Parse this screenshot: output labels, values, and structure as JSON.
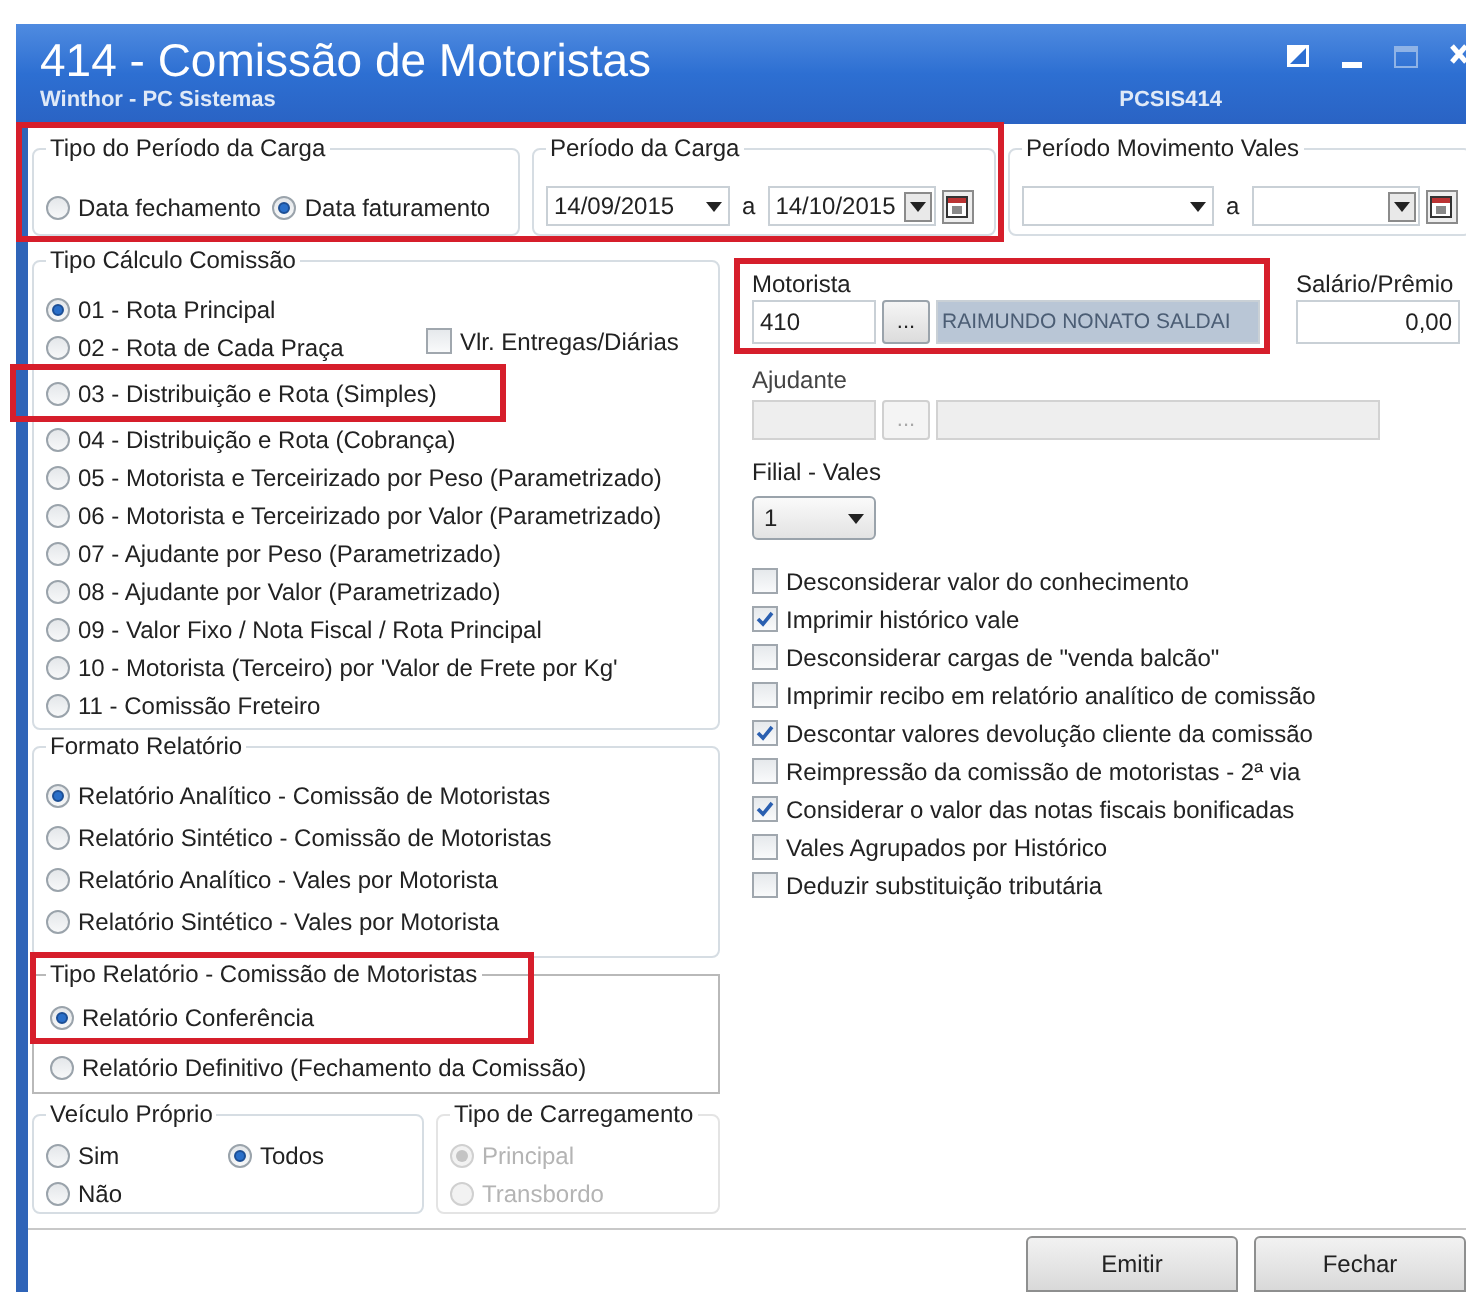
{
  "window": {
    "title": "414 - Comissão de Motoristas",
    "subtitle": "Winthor - PC Sistemas",
    "code": "PCSIS414"
  },
  "tipo_periodo_carga": {
    "title": "Tipo do Período da Carga",
    "options": [
      {
        "label": "Data fechamento",
        "selected": false
      },
      {
        "label": "Data faturamento",
        "selected": true
      }
    ]
  },
  "periodo_carga": {
    "title": "Período da Carga",
    "from": "14/09/2015",
    "separator": "a",
    "to": "14/10/2015"
  },
  "periodo_movimento_vales": {
    "title": "Período Movimento Vales",
    "separator": "a"
  },
  "tipo_calculo_comissao": {
    "title": "Tipo Cálculo Comissão",
    "options": [
      {
        "label": "01 - Rota Principal",
        "selected": true
      },
      {
        "label": "02 - Rota de Cada Praça",
        "selected": false
      },
      {
        "label": "03 - Distribuição e Rota (Simples)",
        "selected": false
      },
      {
        "label": "04 - Distribuição e Rota (Cobrança)",
        "selected": false
      },
      {
        "label": "05 - Motorista e Terceirizado por Peso (Parametrizado)",
        "selected": false
      },
      {
        "label": "06 - Motorista e Terceirizado por Valor (Parametrizado)",
        "selected": false
      },
      {
        "label": "07 - Ajudante por Peso (Parametrizado)",
        "selected": false
      },
      {
        "label": "08 - Ajudante por Valor (Parametrizado)",
        "selected": false
      },
      {
        "label": "09 - Valor Fixo / Nota Fiscal / Rota Principal",
        "selected": false
      },
      {
        "label": "10 - Motorista (Terceiro) por 'Valor de Frete por Kg'",
        "selected": false
      },
      {
        "label": "11 - Comissão Freteiro",
        "selected": false
      }
    ],
    "checkbox": {
      "label": "Vlr. Entregas/Diárias",
      "checked": false
    }
  },
  "formato_relatorio": {
    "title": "Formato Relatório",
    "options": [
      {
        "label": "Relatório Analítico - Comissão de Motoristas",
        "selected": true
      },
      {
        "label": "Relatório Sintético - Comissão de Motoristas",
        "selected": false
      },
      {
        "label": "Relatório Analítico - Vales por Motorista",
        "selected": false
      },
      {
        "label": "Relatório Sintético - Vales por Motorista",
        "selected": false
      }
    ]
  },
  "tipo_relatorio": {
    "title": "Tipo Relatório - Comissão de Motoristas",
    "options": [
      {
        "label": "Relatório Conferência",
        "selected": true
      },
      {
        "label": "Relatório Definitivo (Fechamento da Comissão)",
        "selected": false
      }
    ]
  },
  "veiculo_proprio": {
    "title": "Veículo Próprio",
    "options": [
      {
        "label": "Sim",
        "selected": false
      },
      {
        "label": "Todos",
        "selected": true
      },
      {
        "label": "Não",
        "selected": false
      }
    ]
  },
  "tipo_carregamento": {
    "title": "Tipo de Carregamento",
    "disabled": true,
    "options": [
      {
        "label": "Principal",
        "selected": true
      },
      {
        "label": "Transbordo",
        "selected": false
      }
    ]
  },
  "motorista": {
    "label": "Motorista",
    "code": "410",
    "lookup": "...",
    "name": "RAIMUNDO NONATO SALDAI"
  },
  "salario_premio": {
    "label": "Salário/Prêmio",
    "value": "0,00"
  },
  "ajudante": {
    "label": "Ajudante",
    "lookup": "...",
    "disabled": true
  },
  "filial_vales": {
    "label": "Filial - Vales",
    "value": "1"
  },
  "options": [
    {
      "label": "Desconsiderar valor do conhecimento",
      "checked": false
    },
    {
      "label": "Imprimir histórico vale",
      "checked": true
    },
    {
      "label": "Desconsiderar cargas de \"venda balcão\"",
      "checked": false
    },
    {
      "label": "Imprimir recibo em relatório analítico de comissão",
      "checked": false
    },
    {
      "label": "Descontar valores devolução cliente da comissão",
      "checked": true
    },
    {
      "label": "Reimpressão da comissão de motoristas  - 2ª via",
      "checked": false
    },
    {
      "label": "Considerar o valor das notas fiscais bonificadas",
      "checked": true
    },
    {
      "label": "Vales Agrupados por Histórico",
      "checked": false
    },
    {
      "label": "Deduzir substituição tributária",
      "checked": false
    }
  ],
  "buttons": [
    {
      "label": "Emitir"
    },
    {
      "label": "Fechar"
    }
  ]
}
